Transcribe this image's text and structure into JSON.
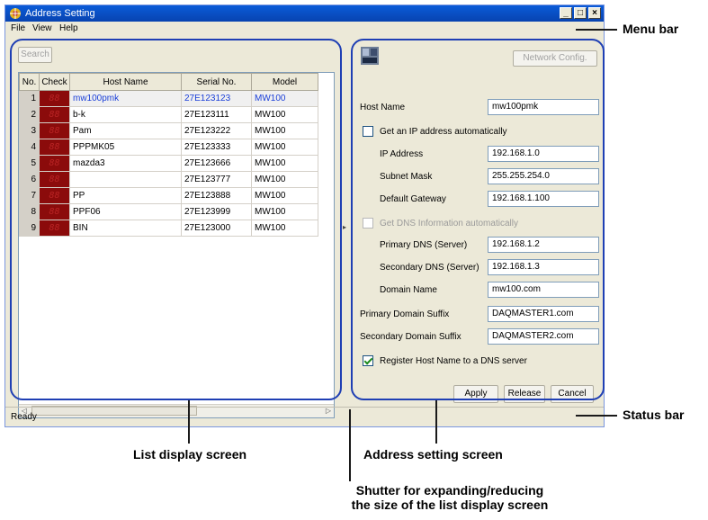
{
  "window": {
    "title": "Address Setting",
    "controls": [
      "_",
      "□",
      "×"
    ]
  },
  "menu": {
    "items": [
      "File",
      "View",
      "Help"
    ]
  },
  "list": {
    "search_label": "Search",
    "columns": [
      "No.",
      "Check",
      "Host Name",
      "Serial No.",
      "Model"
    ],
    "rows": [
      {
        "no": "1",
        "check": "88",
        "host": "mw100pmk",
        "serial": "27E123123",
        "model": "MW100",
        "selected": true
      },
      {
        "no": "2",
        "check": "88",
        "host": "b-k",
        "serial": "27E123111",
        "model": "MW100"
      },
      {
        "no": "3",
        "check": "88",
        "host": "Pam",
        "serial": "27E123222",
        "model": "MW100"
      },
      {
        "no": "4",
        "check": "88",
        "host": "PPPMK05",
        "serial": "27E123333",
        "model": "MW100"
      },
      {
        "no": "5",
        "check": "88",
        "host": "mazda3",
        "serial": "27E123666",
        "model": "MW100"
      },
      {
        "no": "6",
        "check": "88",
        "host": "",
        "serial": "27E123777",
        "model": "MW100"
      },
      {
        "no": "7",
        "check": "88",
        "host": "PP",
        "serial": "27E123888",
        "model": "MW100"
      },
      {
        "no": "8",
        "check": "88",
        "host": "PPF06",
        "serial": "27E123999",
        "model": "MW100"
      },
      {
        "no": "9",
        "check": "88",
        "host": "BIN",
        "serial": "27E123000",
        "model": "MW100"
      }
    ]
  },
  "address": {
    "network_config_label": "Network Config.",
    "host_name_label": "Host Name",
    "host_name_value": "mw100pmk",
    "auto_ip_label": "Get an IP address automatically",
    "auto_ip_checked": false,
    "ip_label": "IP Address",
    "ip_value": "192.168.1.0",
    "subnet_label": "Subnet Mask",
    "subnet_value": "255.255.254.0",
    "gateway_label": "Default Gateway",
    "gateway_value": "192.168.1.100",
    "auto_dns_label": "Get DNS Information automatically",
    "auto_dns_checked": false,
    "primary_dns_label": "Primary DNS (Server)",
    "primary_dns_value": "192.168.1.2",
    "secondary_dns_label": "Secondary DNS (Server)",
    "secondary_dns_value": "192.168.1.3",
    "domain_label": "Domain Name",
    "domain_value": "mw100.com",
    "primary_suffix_label": "Primary Domain Suffix",
    "primary_suffix_value": "DAQMASTER1.com",
    "secondary_suffix_label": "Secondary Domain Suffix",
    "secondary_suffix_value": "DAQMASTER2.com",
    "register_label": "Register Host Name to a DNS server",
    "register_checked": true,
    "apply_label": "Apply",
    "release_label": "Release",
    "cancel_label": "Cancel"
  },
  "status": {
    "text": "Ready"
  },
  "annotations": {
    "menu_bar": "Menu bar",
    "status_bar": "Status bar",
    "list_display": "List display screen",
    "address_setting": "Address setting screen",
    "shutter_line1": "Shutter for expanding/reducing",
    "shutter_line2": "the size of the list display screen"
  },
  "colors": {
    "title_bar": "#0a5bd8",
    "annotation_outline": "#1f3fb4",
    "selected_text": "#1a3fd8",
    "led_background": "#8b0b0b"
  }
}
